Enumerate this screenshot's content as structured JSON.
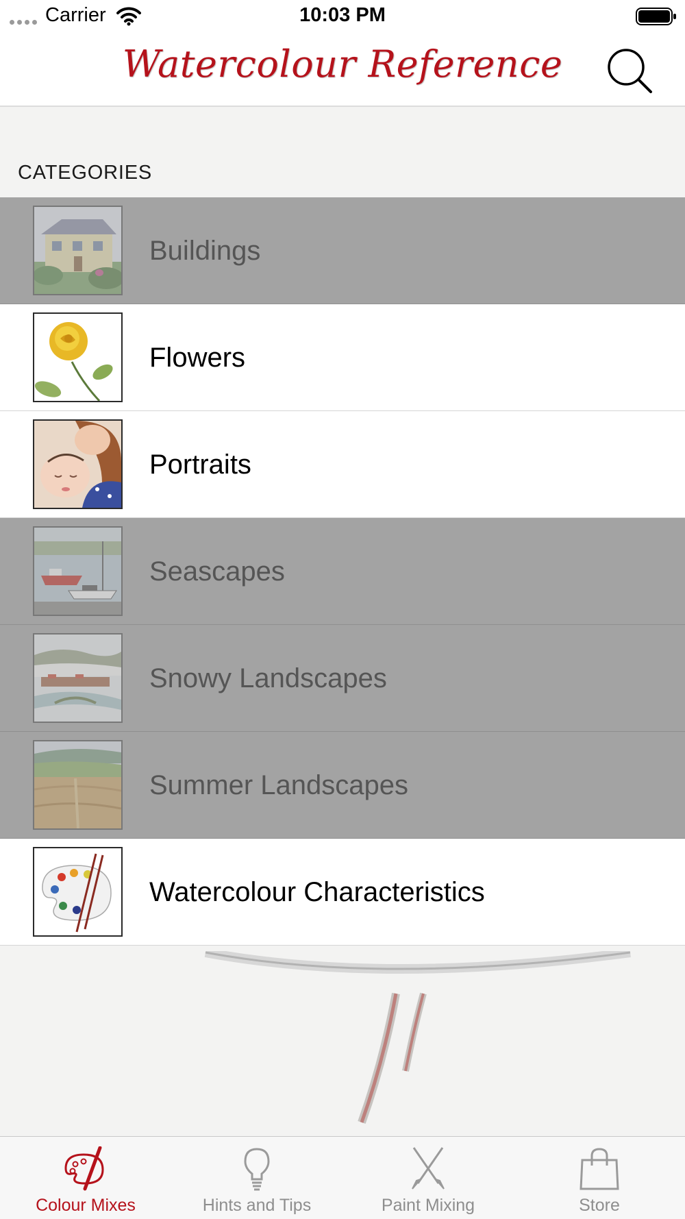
{
  "status_bar": {
    "carrier": "Carrier",
    "time": "10:03 PM"
  },
  "header": {
    "title": "Watercolour Reference",
    "search_icon": "search-icon",
    "accent_color": "#b5121b"
  },
  "section": {
    "title": "CATEGORIES"
  },
  "categories": [
    {
      "label": "Buildings",
      "enabled": false
    },
    {
      "label": "Flowers",
      "enabled": true
    },
    {
      "label": "Portraits",
      "enabled": true
    },
    {
      "label": "Seascapes",
      "enabled": false
    },
    {
      "label": "Snowy Landscapes",
      "enabled": false
    },
    {
      "label": "Summer Landscapes",
      "enabled": false
    },
    {
      "label": "Watercolour Characteristics",
      "enabled": true
    }
  ],
  "tabs": [
    {
      "label": "Colour Mixes",
      "icon": "palette-icon",
      "active": true
    },
    {
      "label": "Hints and Tips",
      "icon": "lightbulb-icon",
      "active": false
    },
    {
      "label": "Paint Mixing",
      "icon": "crossed-brushes-icon",
      "active": false
    },
    {
      "label": "Store",
      "icon": "shopping-bag-icon",
      "active": false
    }
  ]
}
